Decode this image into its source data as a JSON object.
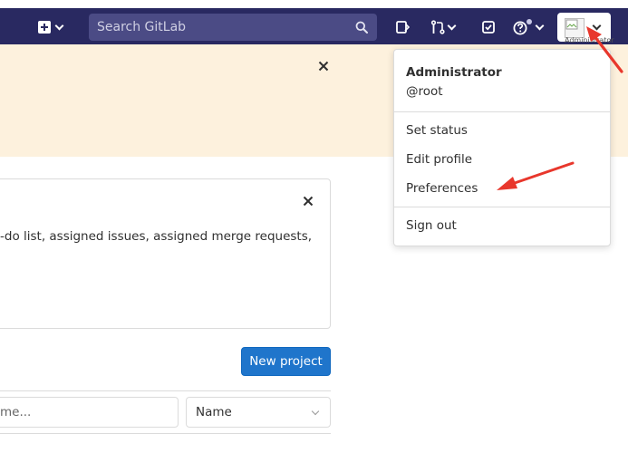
{
  "navbar": {
    "search_placeholder": "Search GitLab",
    "icons": [
      "plus-square-icon",
      "chevron-down-icon",
      "search-icon",
      "issues-icon",
      "merge-request-icon",
      "todo-icon",
      "help-icon"
    ],
    "avatar_alt": "Administrator"
  },
  "colors": {
    "navbar": "#292961",
    "search": "#4b4b85",
    "banner": "#fdf1dd",
    "primary_button": "#1f75cb",
    "annotation": "#e8372c"
  },
  "welcome_card": {
    "text": "-do list, assigned issues, assigned merge requests,"
  },
  "actions": {
    "new_project_label": "New project"
  },
  "filters": {
    "search_partial_text": "me...",
    "sort_selected": "Name"
  },
  "user_menu": {
    "name": "Administrator",
    "username": "@root",
    "items": [
      "Set status",
      "Edit profile",
      "Preferences"
    ],
    "sign_out": "Sign out"
  }
}
